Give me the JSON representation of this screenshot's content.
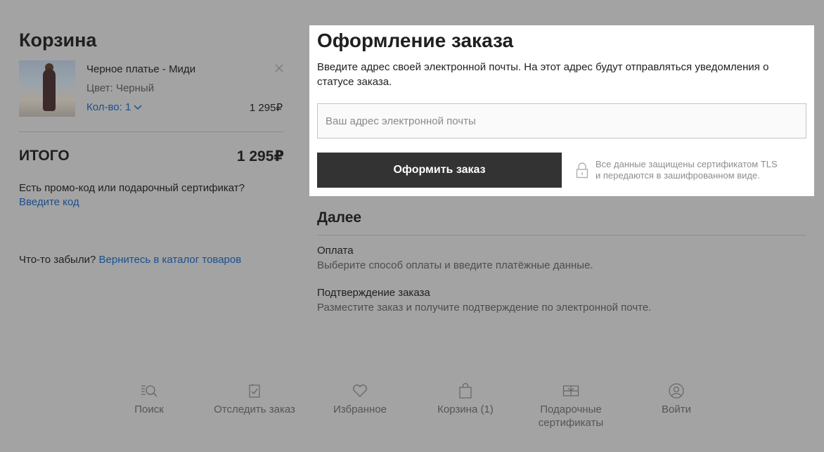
{
  "cart": {
    "title": "Корзина",
    "item": {
      "name": "Черное платье - Миди",
      "color": "Цвет: Черный",
      "qty": "Кол-во: 1",
      "price": "1 295₽"
    },
    "total_label": "ИТОГО",
    "total_value": "1 295₽",
    "promo_question": "Есть промо-код или подарочный сертификат?",
    "promo_link": "Введите код",
    "forgot_text": "Что-то забыли?",
    "forgot_link": "Вернитесь в каталог товаров"
  },
  "checkout": {
    "title": "Оформление заказа",
    "description": "Введите адрес своей электронной почты. На этот адрес будут отправляться уведомления о статусе заказа.",
    "email_placeholder": "Ваш адрес электронной почты",
    "email_value": "",
    "submit_label": "Оформить заказ",
    "security_line1": "Все данные защищены сертификатом TLS",
    "security_line2": "и передаются в зашифрованном виде."
  },
  "next": {
    "title": "Далее",
    "steps": [
      {
        "title": "Оплата",
        "desc": "Выберите способ оплаты и введите платёжные данные."
      },
      {
        "title": "Подтверждение заказа",
        "desc": "Разместите заказ и получите подтверждение по электронной почте."
      }
    ]
  },
  "footer_nav": {
    "items": [
      {
        "label": "Поиск",
        "icon": "search-icon"
      },
      {
        "label": "Отследить заказ",
        "icon": "track-order-icon"
      },
      {
        "label": "Избранное",
        "icon": "heart-icon"
      },
      {
        "label": "Корзина (1)",
        "icon": "bag-icon"
      },
      {
        "label_line1": "Подарочные",
        "label_line2": "сертификаты",
        "icon": "gift-card-icon"
      },
      {
        "label": "Войти",
        "icon": "user-icon"
      }
    ]
  },
  "colors": {
    "overlay": "#a3a3a3",
    "panel": "#ffffff",
    "button": "#333333",
    "link": "#1a4f8f"
  }
}
